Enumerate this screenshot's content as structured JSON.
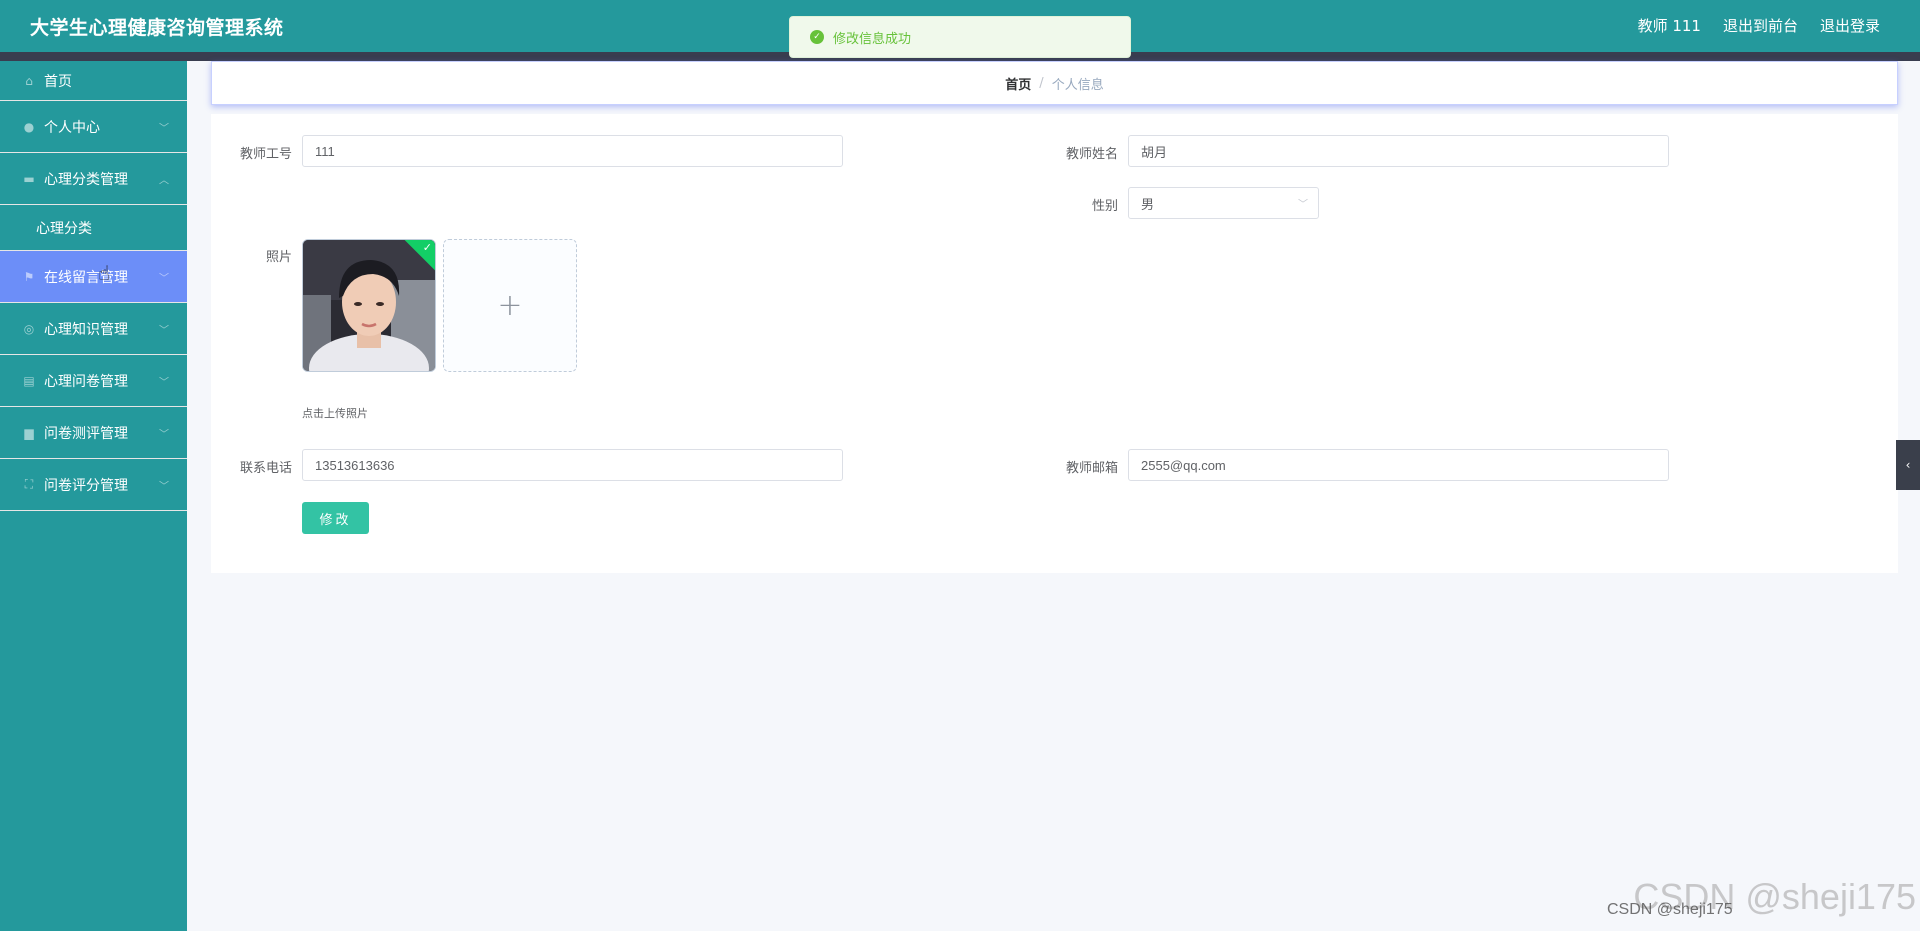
{
  "header": {
    "title": "大学生心理健康咨询管理系统",
    "user_label": "教师 111",
    "to_front_label": "退出到前台",
    "logout_label": "退出登录"
  },
  "toast": {
    "message": "修改信息成功"
  },
  "sidebar": {
    "items": [
      {
        "label": "首页",
        "icon": "home-icon"
      },
      {
        "label": "个人中心",
        "icon": "user-icon"
      },
      {
        "label": "心理分类管理",
        "icon": "folder-icon"
      },
      {
        "label": "心理分类",
        "icon": ""
      },
      {
        "label": "在线留言管理",
        "icon": "flag-icon"
      },
      {
        "label": "心理知识管理",
        "icon": "globe-icon"
      },
      {
        "label": "心理问卷管理",
        "icon": "clipboard-icon"
      },
      {
        "label": "问卷测评管理",
        "icon": "printer-icon"
      },
      {
        "label": "问卷评分管理",
        "icon": "crop-icon"
      }
    ]
  },
  "breadcrumb": {
    "home": "首页",
    "separator": "/",
    "current": "个人信息"
  },
  "form": {
    "teacher_id_label": "教师工号",
    "teacher_id_value": "111",
    "teacher_name_label": "教师姓名",
    "teacher_name_value": "胡月",
    "gender_label": "性别",
    "gender_value": "男",
    "photo_label": "照片",
    "upload_tip": "点击上传照片",
    "phone_label": "联系电话",
    "phone_value": "13513613636",
    "email_label": "教师邮箱",
    "email_value": "2555@qq.com",
    "submit_label": "修改"
  },
  "watermark": {
    "main": "CSDN @sheji175",
    "secondary": "CSDN @sheji175"
  },
  "colors": {
    "header": "#24999c",
    "active_menu": "#6c8ef8",
    "submit": "#33c3a4",
    "success": "#67c23a"
  }
}
